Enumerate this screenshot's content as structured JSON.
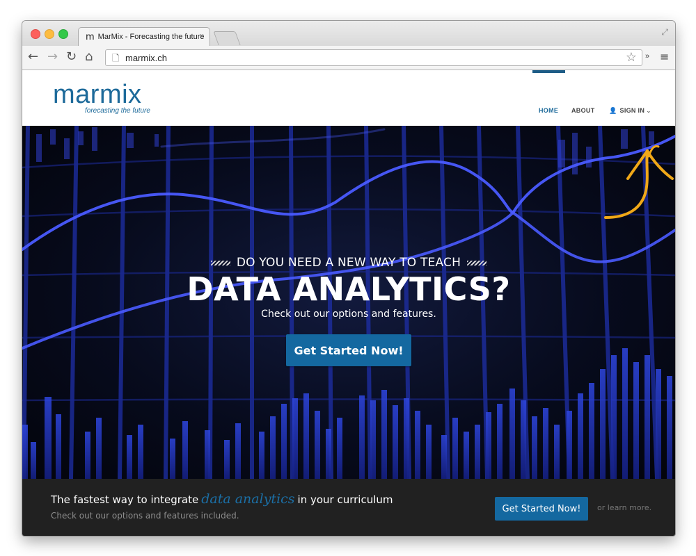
{
  "browser": {
    "tab_favicon": "m",
    "tab_title": "MarMix - Forecasting the future",
    "tab_close": "×",
    "url": "marmix.ch",
    "extensions_more": "»",
    "icons": [
      "back-icon",
      "forward-icon",
      "reload-icon",
      "home-icon",
      "page-icon",
      "bookmark-star-icon",
      "menu-icon",
      "fullscreen-icon"
    ]
  },
  "site": {
    "logo_word": "marmix",
    "logo_tagline": "forecasting the future",
    "nav": {
      "home": "HOME",
      "about": "ABOUT",
      "signin": "SIGN IN"
    },
    "hero": {
      "pretitle": "DO YOU NEED A NEW WAY TO TEACH",
      "title": "DATA ANALYTICS?",
      "subtitle": "Check out our options and features.",
      "cta": "Get Started Now!"
    },
    "strip": {
      "lead_before": "The fastest way to integrate",
      "lead_highlight": "data analytics",
      "lead_after": "in your curriculum",
      "sub": "Check out our options and features included.",
      "cta": "Get Started Now!",
      "learn_more": "or learn more."
    }
  },
  "colors": {
    "brand": "#1d6a9a",
    "button": "#1468a0",
    "strip_bg": "#212121",
    "annotation": "#f0a818"
  }
}
